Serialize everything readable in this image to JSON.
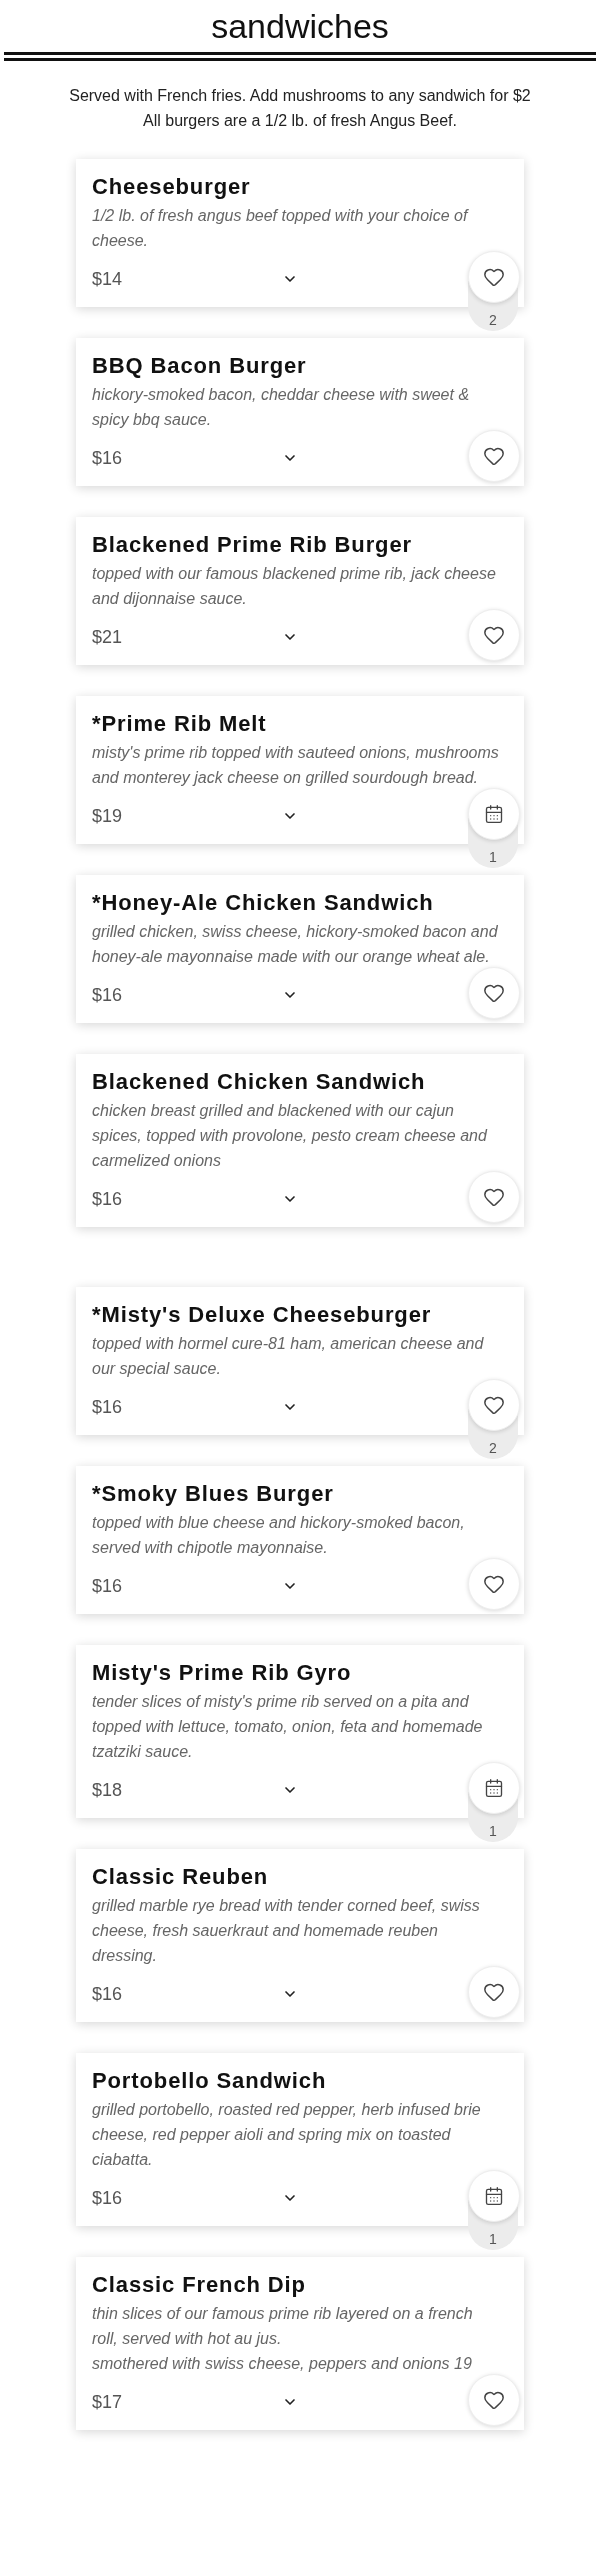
{
  "heading": "sandwiches",
  "intro": [
    "Served with French fries. Add mushrooms to any sandwich for $2",
    "All burgers are a 1/2 lb. of fresh Angus Beef."
  ],
  "groups": [
    [
      {
        "name": "Cheeseburger",
        "description": "1/2 lb. of fresh angus beef topped with your choice of cheese.",
        "price": "$14",
        "action": {
          "kind": "heart",
          "count": "2"
        }
      },
      {
        "name": "BBQ Bacon Burger",
        "description": "hickory-smoked bacon, cheddar cheese with sweet & spicy bbq sauce.",
        "price": "$16",
        "action": {
          "kind": "heart"
        }
      },
      {
        "name": "Blackened Prime Rib Burger",
        "description": "topped with our famous blackened prime rib, jack cheese and dijonnaise sauce.",
        "price": "$21",
        "action": {
          "kind": "heart"
        }
      },
      {
        "name": "*Prime Rib Melt",
        "description": "misty's prime rib topped with sauteed onions, mushrooms and monterey jack cheese on grilled sourdough bread.",
        "price": "$19",
        "action": {
          "kind": "calendar",
          "count": "1"
        }
      },
      {
        "name": "*Honey-Ale Chicken Sandwich",
        "description": "grilled chicken, swiss cheese, hickory-smoked bacon and honey-ale mayonnaise made with our orange wheat ale.",
        "price": "$16",
        "action": {
          "kind": "heart"
        }
      },
      {
        "name": "Blackened Chicken Sandwich",
        "description": "chicken breast grilled and blackened with our cajun spices, topped with provolone, pesto cream cheese and carmelized onions",
        "price": "$16",
        "action": {
          "kind": "heart"
        }
      }
    ],
    [
      {
        "name": "*Misty's Deluxe Cheeseburger",
        "description": "topped with hormel cure-81 ham, american cheese and our special sauce.",
        "price": "$16",
        "action": {
          "kind": "heart",
          "count": "2"
        }
      },
      {
        "name": "*Smoky Blues Burger",
        "description": "topped with blue cheese and hickory-smoked bacon, served with chipotle mayonnaise.",
        "price": "$16",
        "action": {
          "kind": "heart"
        }
      },
      {
        "name": "Misty's Prime Rib Gyro",
        "description": "tender slices of misty's prime rib served on a pita and topped with lettuce, tomato, onion, feta and homemade tzatziki sauce.",
        "price": "$18",
        "action": {
          "kind": "calendar",
          "count": "1"
        }
      },
      {
        "name": "Classic Reuben",
        "description": "grilled marble rye bread with tender corned beef, swiss cheese, fresh sauerkraut and homemade reuben dressing.",
        "price": "$16",
        "action": {
          "kind": "heart"
        }
      },
      {
        "name": "Portobello Sandwich",
        "description": "grilled portobello, roasted red pepper, herb infused brie cheese, red pepper aioli and spring mix on toasted ciabatta.",
        "price": "$16",
        "action": {
          "kind": "calendar",
          "count": "1"
        }
      },
      {
        "name": "Classic French Dip",
        "description": "thin slices of our famous prime rib layered on a french roll, served with hot au jus.\nsmothered with swiss cheese, peppers and onions 19",
        "price": "$17",
        "action": {
          "kind": "heart"
        }
      }
    ]
  ]
}
